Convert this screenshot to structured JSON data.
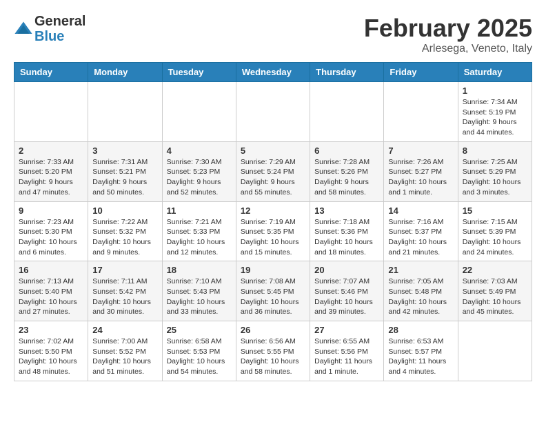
{
  "header": {
    "logo_line1": "General",
    "logo_line2": "Blue",
    "month_title": "February 2025",
    "location": "Arlesega, Veneto, Italy"
  },
  "days_of_week": [
    "Sunday",
    "Monday",
    "Tuesday",
    "Wednesday",
    "Thursday",
    "Friday",
    "Saturday"
  ],
  "weeks": [
    [
      {
        "day": "",
        "info": ""
      },
      {
        "day": "",
        "info": ""
      },
      {
        "day": "",
        "info": ""
      },
      {
        "day": "",
        "info": ""
      },
      {
        "day": "",
        "info": ""
      },
      {
        "day": "",
        "info": ""
      },
      {
        "day": "1",
        "info": "Sunrise: 7:34 AM\nSunset: 5:19 PM\nDaylight: 9 hours and 44 minutes."
      }
    ],
    [
      {
        "day": "2",
        "info": "Sunrise: 7:33 AM\nSunset: 5:20 PM\nDaylight: 9 hours and 47 minutes."
      },
      {
        "day": "3",
        "info": "Sunrise: 7:31 AM\nSunset: 5:21 PM\nDaylight: 9 hours and 50 minutes."
      },
      {
        "day": "4",
        "info": "Sunrise: 7:30 AM\nSunset: 5:23 PM\nDaylight: 9 hours and 52 minutes."
      },
      {
        "day": "5",
        "info": "Sunrise: 7:29 AM\nSunset: 5:24 PM\nDaylight: 9 hours and 55 minutes."
      },
      {
        "day": "6",
        "info": "Sunrise: 7:28 AM\nSunset: 5:26 PM\nDaylight: 9 hours and 58 minutes."
      },
      {
        "day": "7",
        "info": "Sunrise: 7:26 AM\nSunset: 5:27 PM\nDaylight: 10 hours and 1 minute."
      },
      {
        "day": "8",
        "info": "Sunrise: 7:25 AM\nSunset: 5:29 PM\nDaylight: 10 hours and 3 minutes."
      }
    ],
    [
      {
        "day": "9",
        "info": "Sunrise: 7:23 AM\nSunset: 5:30 PM\nDaylight: 10 hours and 6 minutes."
      },
      {
        "day": "10",
        "info": "Sunrise: 7:22 AM\nSunset: 5:32 PM\nDaylight: 10 hours and 9 minutes."
      },
      {
        "day": "11",
        "info": "Sunrise: 7:21 AM\nSunset: 5:33 PM\nDaylight: 10 hours and 12 minutes."
      },
      {
        "day": "12",
        "info": "Sunrise: 7:19 AM\nSunset: 5:35 PM\nDaylight: 10 hours and 15 minutes."
      },
      {
        "day": "13",
        "info": "Sunrise: 7:18 AM\nSunset: 5:36 PM\nDaylight: 10 hours and 18 minutes."
      },
      {
        "day": "14",
        "info": "Sunrise: 7:16 AM\nSunset: 5:37 PM\nDaylight: 10 hours and 21 minutes."
      },
      {
        "day": "15",
        "info": "Sunrise: 7:15 AM\nSunset: 5:39 PM\nDaylight: 10 hours and 24 minutes."
      }
    ],
    [
      {
        "day": "16",
        "info": "Sunrise: 7:13 AM\nSunset: 5:40 PM\nDaylight: 10 hours and 27 minutes."
      },
      {
        "day": "17",
        "info": "Sunrise: 7:11 AM\nSunset: 5:42 PM\nDaylight: 10 hours and 30 minutes."
      },
      {
        "day": "18",
        "info": "Sunrise: 7:10 AM\nSunset: 5:43 PM\nDaylight: 10 hours and 33 minutes."
      },
      {
        "day": "19",
        "info": "Sunrise: 7:08 AM\nSunset: 5:45 PM\nDaylight: 10 hours and 36 minutes."
      },
      {
        "day": "20",
        "info": "Sunrise: 7:07 AM\nSunset: 5:46 PM\nDaylight: 10 hours and 39 minutes."
      },
      {
        "day": "21",
        "info": "Sunrise: 7:05 AM\nSunset: 5:48 PM\nDaylight: 10 hours and 42 minutes."
      },
      {
        "day": "22",
        "info": "Sunrise: 7:03 AM\nSunset: 5:49 PM\nDaylight: 10 hours and 45 minutes."
      }
    ],
    [
      {
        "day": "23",
        "info": "Sunrise: 7:02 AM\nSunset: 5:50 PM\nDaylight: 10 hours and 48 minutes."
      },
      {
        "day": "24",
        "info": "Sunrise: 7:00 AM\nSunset: 5:52 PM\nDaylight: 10 hours and 51 minutes."
      },
      {
        "day": "25",
        "info": "Sunrise: 6:58 AM\nSunset: 5:53 PM\nDaylight: 10 hours and 54 minutes."
      },
      {
        "day": "26",
        "info": "Sunrise: 6:56 AM\nSunset: 5:55 PM\nDaylight: 10 hours and 58 minutes."
      },
      {
        "day": "27",
        "info": "Sunrise: 6:55 AM\nSunset: 5:56 PM\nDaylight: 11 hours and 1 minute."
      },
      {
        "day": "28",
        "info": "Sunrise: 6:53 AM\nSunset: 5:57 PM\nDaylight: 11 hours and 4 minutes."
      },
      {
        "day": "",
        "info": ""
      }
    ]
  ]
}
